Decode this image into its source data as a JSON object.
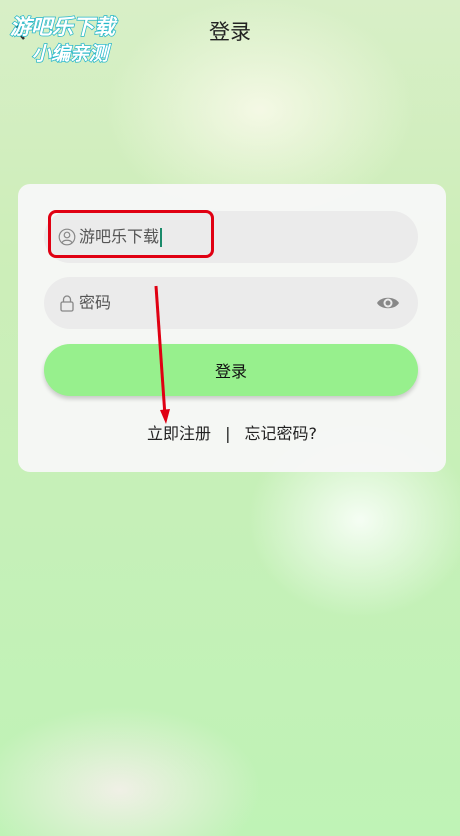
{
  "header": {
    "title": "登录"
  },
  "watermark": {
    "line1": "游吧乐下载",
    "line2": "小编亲测"
  },
  "form": {
    "username_value": "游吧乐下载",
    "password_placeholder": "密码",
    "login_label": "登录"
  },
  "links": {
    "register": "立即注册",
    "separator": "|",
    "forgot": "忘记密码?"
  },
  "colors": {
    "accent": "#97f08d",
    "highlight": "#e00012"
  }
}
